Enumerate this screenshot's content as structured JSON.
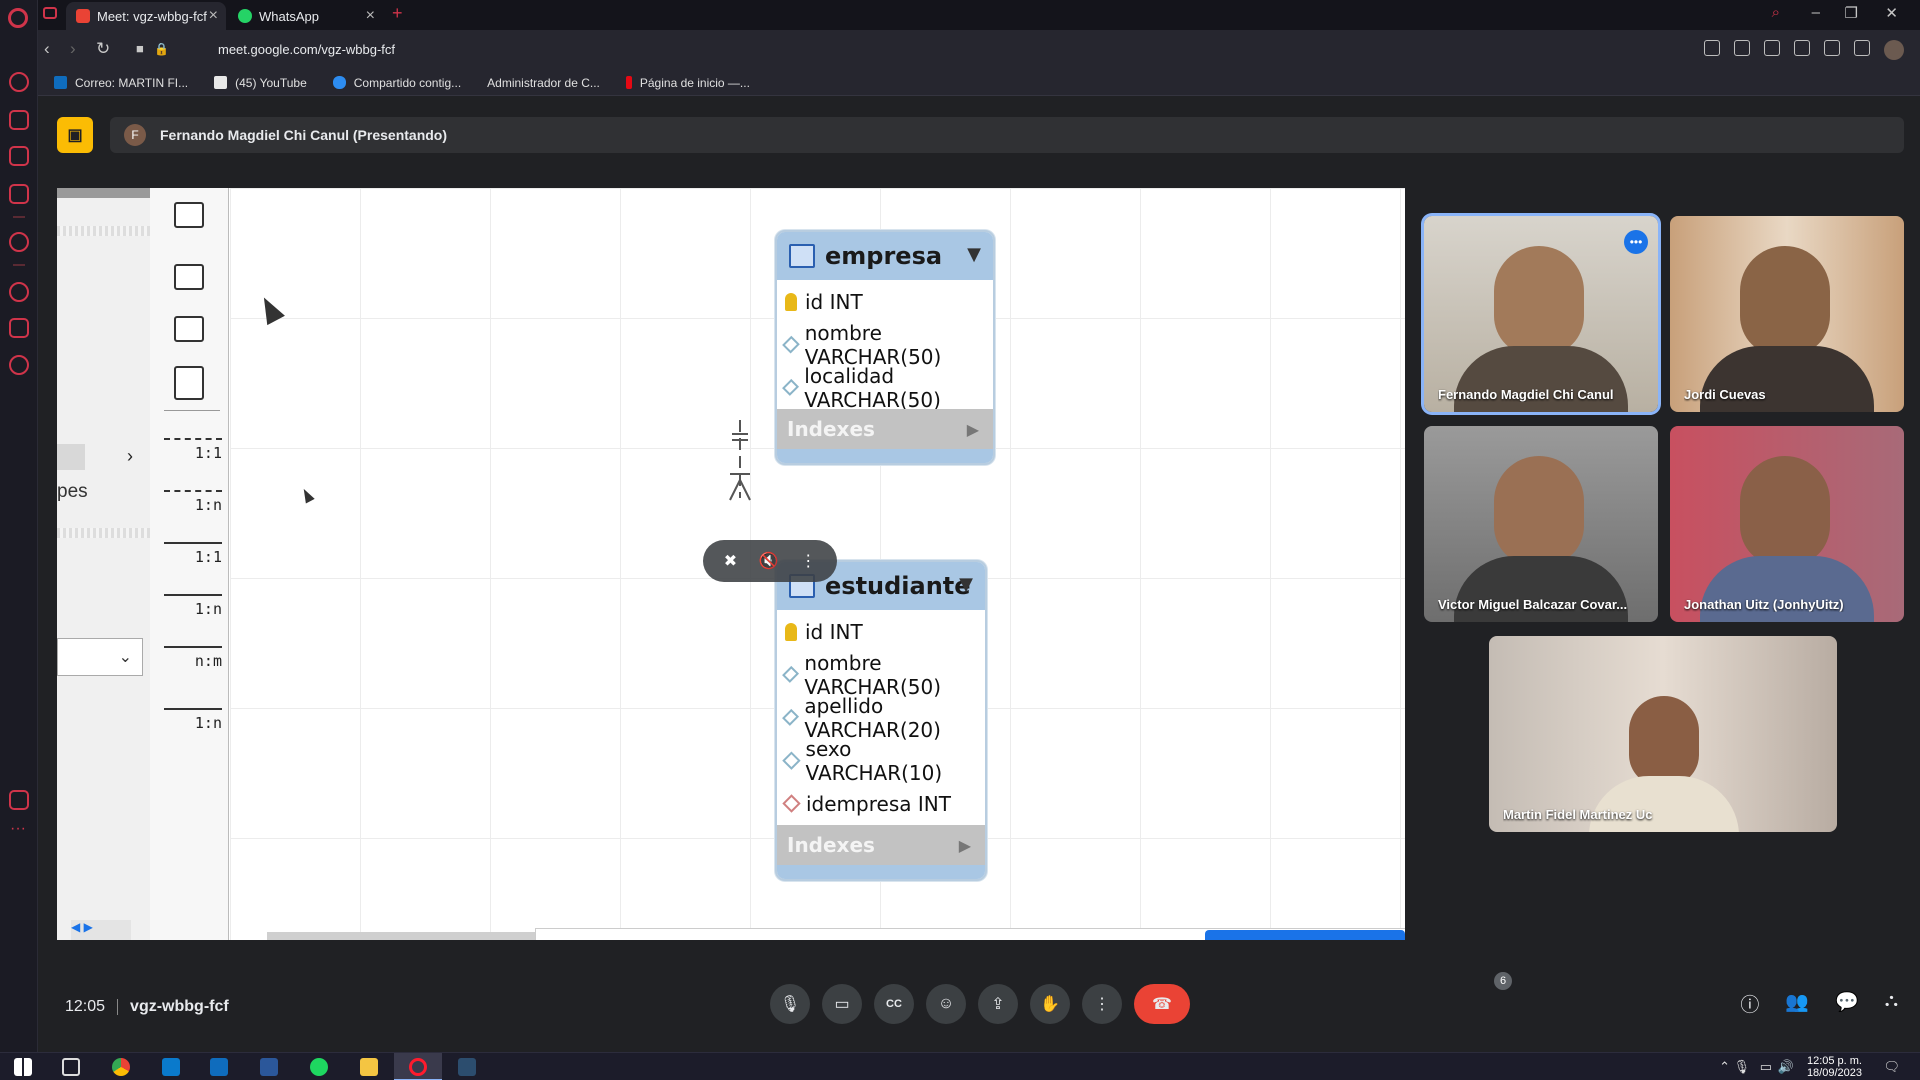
{
  "browser": {
    "tabs": [
      {
        "label": "Meet: vgz-wbbg-fcf",
        "active": true
      },
      {
        "label": "WhatsApp",
        "active": false
      }
    ],
    "url": "meet.google.com/vgz-wbbg-fcf",
    "bookmarks": [
      "Correo: MARTIN FI...",
      "(45) YouTube",
      "Compartido contig...",
      "Administrador de C...",
      "Página de inicio —..."
    ]
  },
  "meet": {
    "presenter_initial": "F",
    "presenter_label": "Fernando Magdiel Chi Canul (Presentando)",
    "time": "12:05",
    "meeting_code": "vgz-wbbg-fcf",
    "participant_count": "6",
    "participants": [
      {
        "name": "Fernando Magdiel Chi Canul",
        "speaking": true
      },
      {
        "name": "Jordi Cuevas"
      },
      {
        "name": "Victor Miguel Balcazar Covar..."
      },
      {
        "name": "Jonathan Uitz (JonhyUitz)"
      },
      {
        "name": "Martin Fidel Martinez Uc"
      }
    ]
  },
  "diagram": {
    "left_panel_text": "pes",
    "relationships": [
      "1:1",
      "1:n",
      "1:1",
      "1:n",
      "n:m",
      "1:n"
    ],
    "entities": [
      {
        "name": "empresa",
        "columns": [
          "id INT",
          "nombre VARCHAR(50)",
          "localidad VARCHAR(50)"
        ],
        "indexes_label": "Indexes"
      },
      {
        "name": "estudiante",
        "columns": [
          "id INT",
          "nombre VARCHAR(50)",
          "apellido VARCHAR(20)",
          "sexo VARCHAR(10)",
          "idempresa INT"
        ],
        "indexes_label": "Indexes"
      }
    ]
  },
  "system": {
    "time": "12:05 p. m.",
    "date": "18/09/2023"
  },
  "colors": {
    "accent": "#1a73e8",
    "present": "#fbbc04",
    "end_call": "#ea4335",
    "entity_header": "#a9c7e4"
  }
}
